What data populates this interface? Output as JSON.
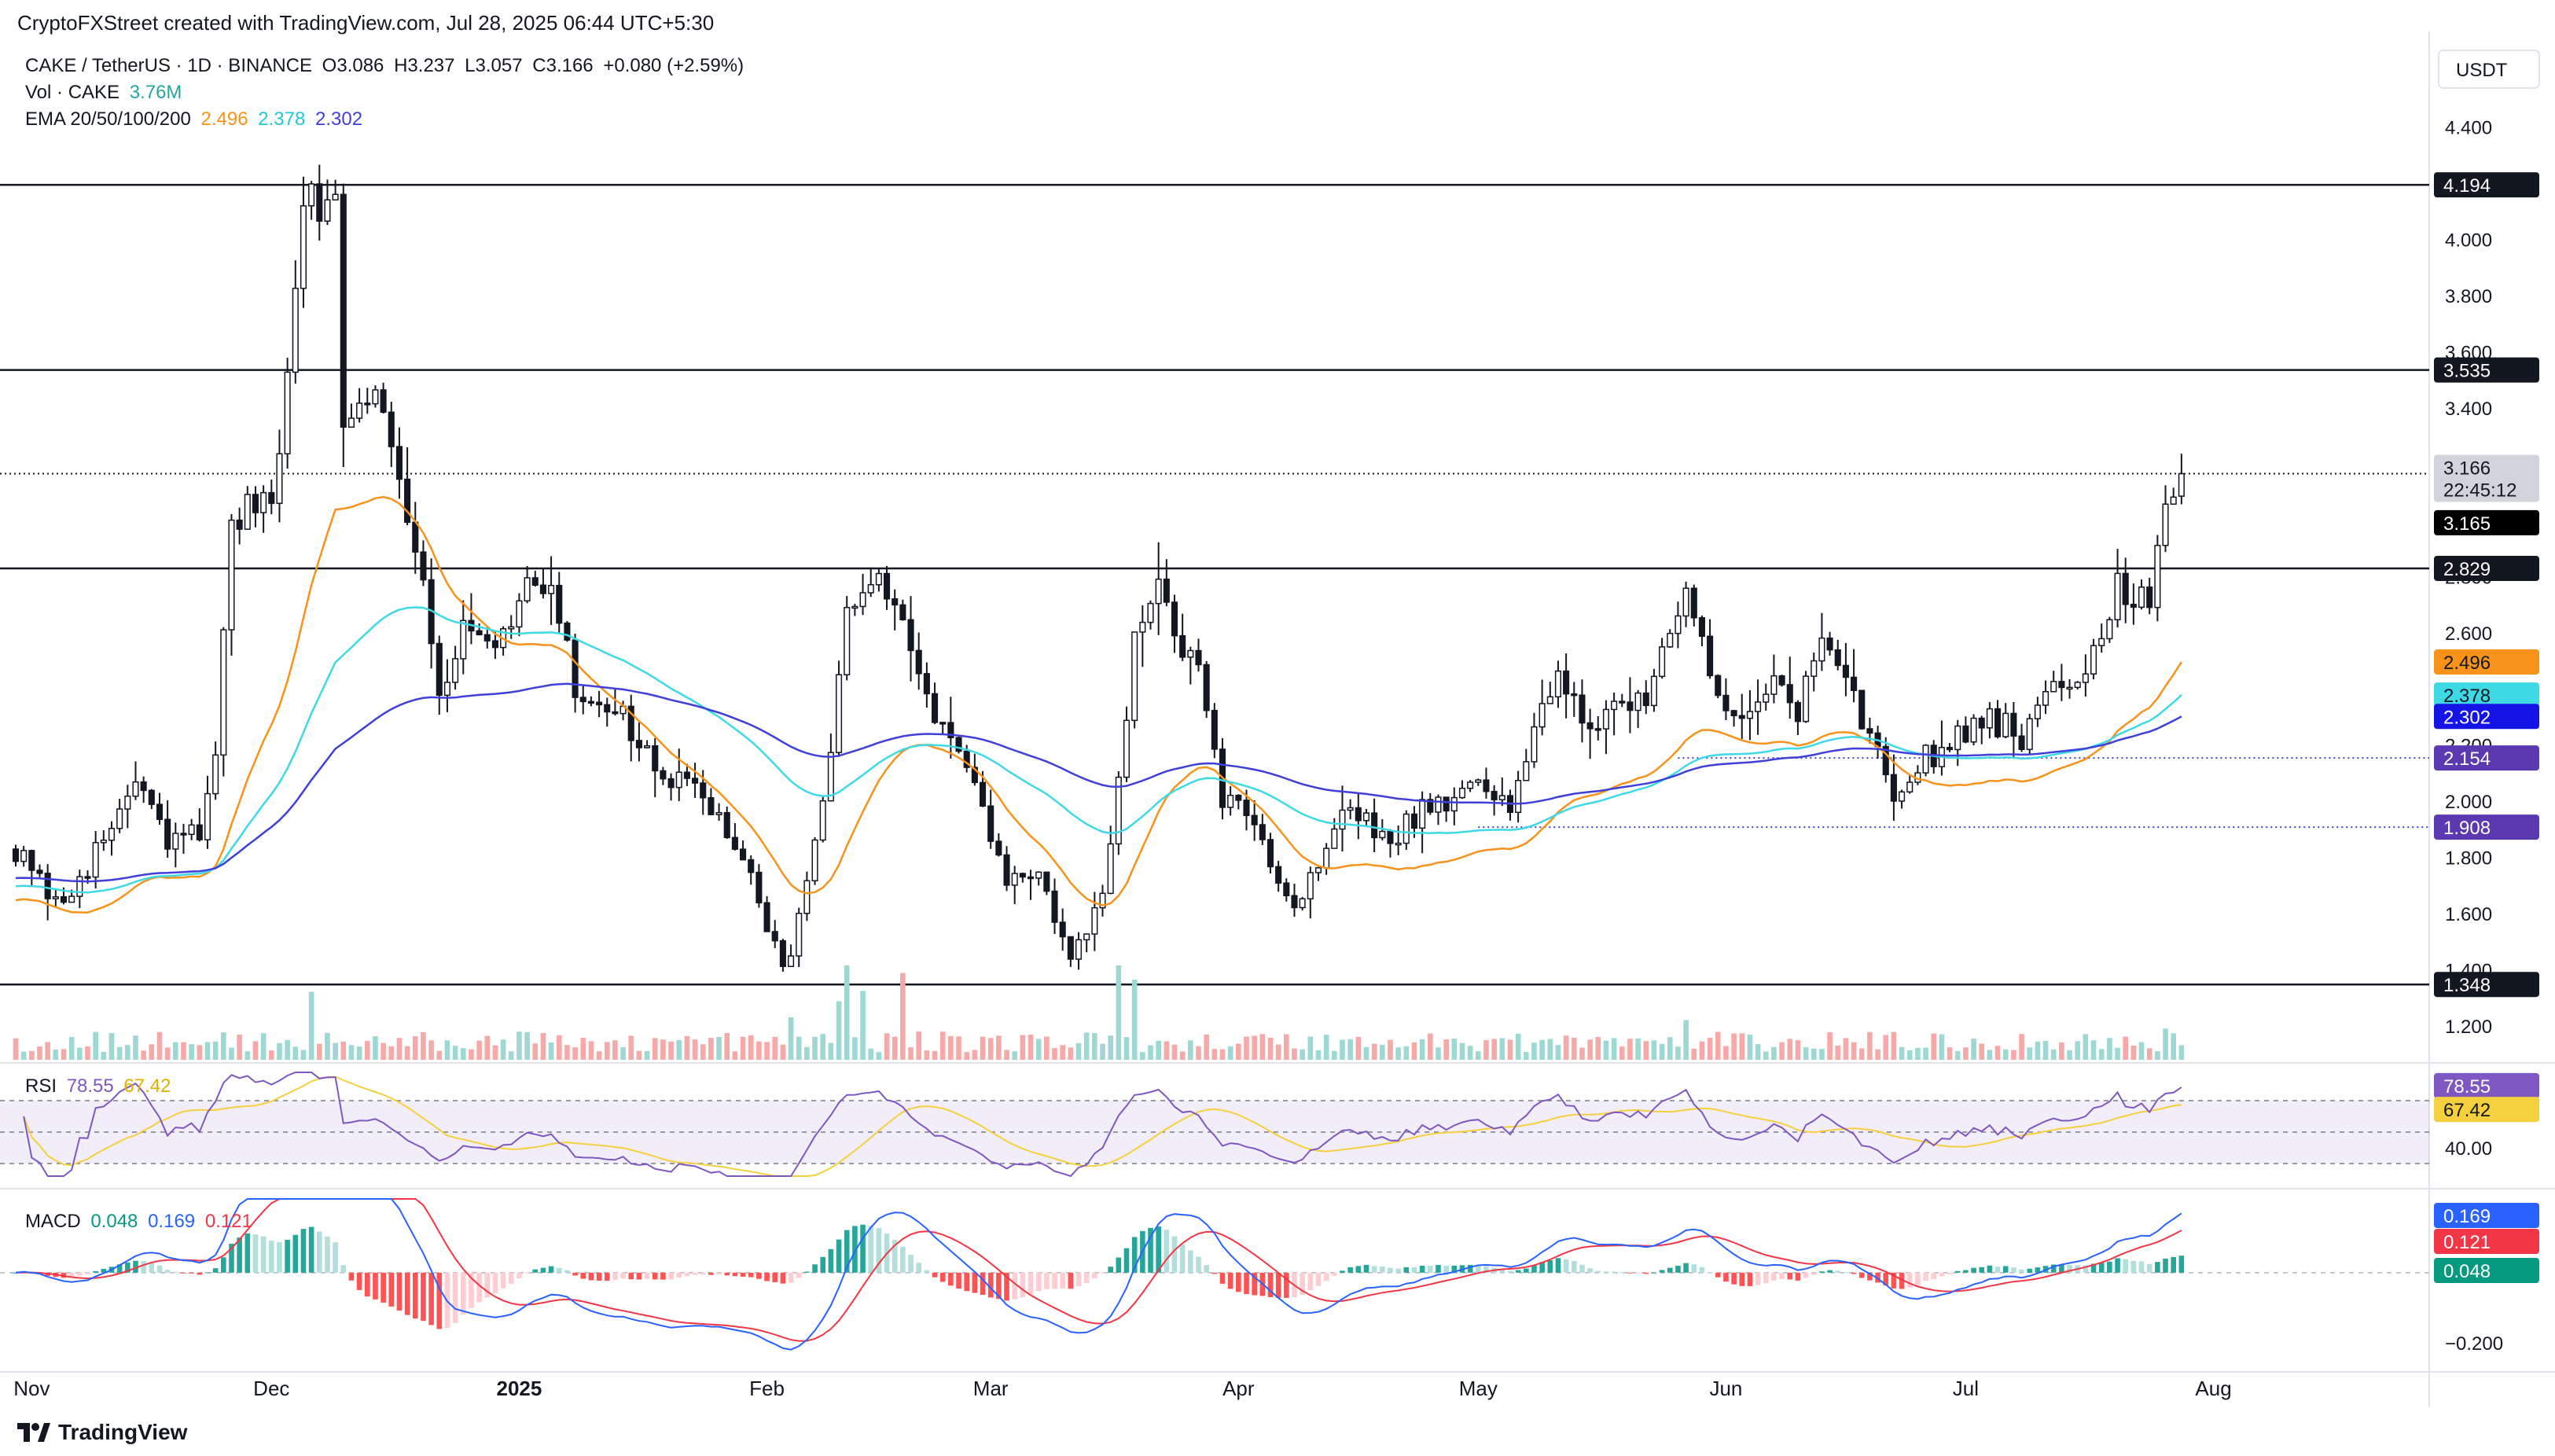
{
  "credit": "CryptoFXStreet created with TradingView.com, Jul 28, 2025 06:44 UTC+5:30",
  "header": {
    "symbol": "CAKE / TetherUS · 1D · BINANCE",
    "o_label": "O",
    "o": "3.086",
    "h_label": "H",
    "h": "3.237",
    "l_label": "L",
    "l": "3.057",
    "c_label": "C",
    "c": "3.166",
    "change": "+0.080 (+2.59%)",
    "vol_label": "Vol · CAKE",
    "vol": "3.76M",
    "ema_label": "EMA 20/50/100/200",
    "ema20": "2.496",
    "ema50": "2.378",
    "ema100": "2.302"
  },
  "currency_button": "USDT",
  "branding": "TradingView",
  "colors": {
    "up": "#26a69a",
    "down": "#ef5350",
    "vol_up": "#9dd8d2",
    "vol_down": "#f7a9a7",
    "ema20": "#f7931a",
    "ema50": "#3fd9e6",
    "ema100": "#3f3fd9",
    "rsi": "#7e57c2",
    "rsi_ma": "#f4d03f",
    "macd": "#2962ff",
    "signal": "#f23645"
  },
  "chart_data": [
    {
      "type": "candlestick",
      "title": "CAKE / TetherUS · 1D · BINANCE",
      "x_range": [
        "2024-10-30",
        "2025-08-28"
      ],
      "ylim": [
        1.08,
        4.74
      ],
      "y_ticks": [
        "1.200",
        "1.400",
        "1.600",
        "1.800",
        "2.000",
        "2.200",
        "2.400",
        "2.600",
        "2.800",
        "3.000",
        "3.200",
        "3.400",
        "3.600",
        "3.800",
        "4.000",
        "4.200",
        "4.400",
        "4.600"
      ],
      "x_labels": [
        {
          "date": "2024-11-01",
          "label": "Nov"
        },
        {
          "date": "2024-12-01",
          "label": "Dec"
        },
        {
          "date": "2025-01-01",
          "label": "2025"
        },
        {
          "date": "2025-02-01",
          "label": "Feb"
        },
        {
          "date": "2025-03-01",
          "label": "Mar"
        },
        {
          "date": "2025-04-01",
          "label": "Apr"
        },
        {
          "date": "2025-05-01",
          "label": "May"
        },
        {
          "date": "2025-06-01",
          "label": "Jun"
        },
        {
          "date": "2025-07-01",
          "label": "Jul"
        },
        {
          "date": "2025-08-01",
          "label": "Aug"
        }
      ],
      "support_resistance": [
        4.194,
        3.535,
        2.829,
        1.348
      ],
      "horizontal_lines": [
        {
          "value": 4.194,
          "style": "solid",
          "label": "4.194"
        },
        {
          "value": 3.535,
          "style": "solid",
          "label": "3.535"
        },
        {
          "value": 2.829,
          "style": "solid",
          "label": "2.829"
        },
        {
          "value": 1.348,
          "style": "solid",
          "label": "1.348"
        },
        {
          "value": 3.166,
          "style": "dotted",
          "label": "3.166"
        },
        {
          "value": 2.154,
          "style": "dotted",
          "start": "2025-05-26",
          "label": "2.154"
        },
        {
          "value": 1.908,
          "style": "dotted",
          "start": "2025-05-01",
          "label": "1.908"
        }
      ],
      "price_labels": [
        {
          "value": 3.166,
          "text": "3.166",
          "sub": "22:45:12",
          "bg": "#d1d4dc",
          "fg": "#131722"
        },
        {
          "value": 3.165,
          "text": "3.165",
          "bg": "#000000",
          "fg": "#ffffff"
        },
        {
          "value": 2.496,
          "text": "2.496",
          "bg": "#f7931a",
          "fg": "#131722"
        },
        {
          "value": 2.378,
          "text": "2.378",
          "bg": "#3fd9e6",
          "fg": "#131722"
        },
        {
          "value": 2.302,
          "text": "2.302",
          "bg": "#1414e6",
          "fg": "#ffffff"
        },
        {
          "value": 2.154,
          "text": "2.154",
          "bg": "#5b3ab1",
          "fg": "#ffffff"
        },
        {
          "value": 1.908,
          "text": "1.908",
          "bg": "#5b3ab1",
          "fg": "#ffffff"
        }
      ],
      "candle_anchors": [
        [
          "2024-10-30",
          1.83
        ],
        [
          "2024-11-04",
          1.62
        ],
        [
          "2024-11-10",
          1.85
        ],
        [
          "2024-11-14",
          2.08
        ],
        [
          "2024-11-18",
          1.84
        ],
        [
          "2024-11-22",
          1.9
        ],
        [
          "2024-11-24",
          2.2
        ],
        [
          "2024-11-26",
          2.95
        ],
        [
          "2024-11-29",
          3.05
        ],
        [
          "2024-12-01",
          3.0
        ],
        [
          "2024-12-03",
          3.5
        ],
        [
          "2024-12-05",
          4.2
        ],
        [
          "2024-12-07",
          4.05
        ],
        [
          "2024-12-09",
          4.2
        ],
        [
          "2024-12-10",
          3.4
        ],
        [
          "2024-12-13",
          3.5
        ],
        [
          "2024-12-16",
          3.3
        ],
        [
          "2024-12-20",
          2.8
        ],
        [
          "2024-12-22",
          2.4
        ],
        [
          "2024-12-25",
          2.6
        ],
        [
          "2024-12-29",
          2.5
        ],
        [
          "2025-01-02",
          2.75
        ],
        [
          "2025-01-05",
          2.8
        ],
        [
          "2025-01-08",
          2.38
        ],
        [
          "2025-01-13",
          2.35
        ],
        [
          "2025-01-18",
          2.1
        ],
        [
          "2025-01-25",
          2.0
        ],
        [
          "2025-01-31",
          1.65
        ],
        [
          "2025-02-03",
          1.38
        ],
        [
          "2025-02-06",
          1.7
        ],
        [
          "2025-02-09",
          2.15
        ],
        [
          "2025-02-11",
          2.65
        ],
        [
          "2025-02-15",
          2.8
        ],
        [
          "2025-02-20",
          2.45
        ],
        [
          "2025-02-24",
          2.22
        ],
        [
          "2025-02-28",
          1.95
        ],
        [
          "2025-03-03",
          1.72
        ],
        [
          "2025-03-07",
          1.75
        ],
        [
          "2025-03-11",
          1.42
        ],
        [
          "2025-03-15",
          1.65
        ],
        [
          "2025-03-17",
          2.05
        ],
        [
          "2025-03-19",
          2.55
        ],
        [
          "2025-03-22",
          2.75
        ],
        [
          "2025-03-27",
          2.45
        ],
        [
          "2025-03-30",
          2.0
        ],
        [
          "2025-04-03",
          1.92
        ],
        [
          "2025-04-08",
          1.62
        ],
        [
          "2025-04-11",
          1.78
        ],
        [
          "2025-04-14",
          1.98
        ],
        [
          "2025-04-20",
          1.85
        ],
        [
          "2025-04-24",
          1.98
        ],
        [
          "2025-04-30",
          2.05
        ],
        [
          "2025-05-05",
          1.98
        ],
        [
          "2025-05-08",
          2.3
        ],
        [
          "2025-05-11",
          2.45
        ],
        [
          "2025-05-16",
          2.25
        ],
        [
          "2025-05-22",
          2.4
        ],
        [
          "2025-05-27",
          2.78
        ],
        [
          "2025-05-30",
          2.4
        ],
        [
          "2025-06-03",
          2.32
        ],
        [
          "2025-06-07",
          2.45
        ],
        [
          "2025-06-10",
          2.3
        ],
        [
          "2025-06-13",
          2.6
        ],
        [
          "2025-06-17",
          2.35
        ],
        [
          "2025-06-20",
          2.18
        ],
        [
          "2025-06-22",
          2.05
        ],
        [
          "2025-06-26",
          2.15
        ],
        [
          "2025-06-30",
          2.25
        ],
        [
          "2025-07-04",
          2.3
        ],
        [
          "2025-07-08",
          2.22
        ],
        [
          "2025-07-11",
          2.45
        ],
        [
          "2025-07-14",
          2.38
        ],
        [
          "2025-07-17",
          2.55
        ],
        [
          "2025-07-20",
          2.75
        ],
        [
          "2025-07-22",
          2.7
        ],
        [
          "2025-07-24",
          2.75
        ],
        [
          "2025-07-26",
          3.09
        ],
        [
          "2025-07-28",
          3.166
        ]
      ],
      "last_candle": {
        "date": "2025-07-28",
        "o": 3.086,
        "h": 3.237,
        "l": 3.057,
        "c": 3.166
      },
      "ema_values": {
        "ema20": 2.496,
        "ema50": 2.378,
        "ema100": 2.302
      }
    },
    {
      "type": "bar",
      "title": "Vol · CAKE",
      "last_value": "3.76M",
      "notable_spikes": [
        {
          "date": "2024-12-06",
          "value_rel": 0.72
        },
        {
          "date": "2025-02-04",
          "value_rel": 0.45
        },
        {
          "date": "2025-02-10",
          "value_rel": 0.62
        },
        {
          "date": "2025-02-11",
          "value_rel": 1.0
        },
        {
          "date": "2025-02-13",
          "value_rel": 0.73
        },
        {
          "date": "2025-02-18",
          "value_rel": 0.92
        },
        {
          "date": "2025-03-17",
          "value_rel": 1.0
        },
        {
          "date": "2025-03-19",
          "value_rel": 0.85
        },
        {
          "date": "2025-05-27",
          "value_rel": 0.42
        },
        {
          "date": "2025-07-26",
          "value_rel": 0.33
        }
      ]
    },
    {
      "type": "line",
      "title": "RSI",
      "series": [
        {
          "name": "RSI",
          "last": "78.55"
        },
        {
          "name": "RSI MA",
          "last": "67.42"
        }
      ],
      "ylim": [
        20,
        90
      ],
      "bands": [
        70,
        50,
        30
      ],
      "y_ticks": [
        "40.00"
      ],
      "price_labels": [
        {
          "value": 78.55,
          "text": "78.55",
          "bg": "#7e57c2",
          "fg": "#ffffff"
        },
        {
          "value": 67.42,
          "text": "67.42",
          "bg": "#f4d03f",
          "fg": "#131722"
        }
      ]
    },
    {
      "type": "bar",
      "title": "MACD",
      "series": [
        {
          "name": "Histogram",
          "last": "0.048"
        },
        {
          "name": "MACD",
          "last": "0.169"
        },
        {
          "name": "Signal",
          "last": "0.121"
        }
      ],
      "ylim": [
        -0.26,
        0.21
      ],
      "y_ticks": [
        "0.000",
        "−0.200"
      ],
      "price_labels": [
        {
          "value": 0.169,
          "text": "0.169",
          "bg": "#2962ff",
          "fg": "#ffffff"
        },
        {
          "value": 0.121,
          "text": "0.121",
          "bg": "#f23645",
          "fg": "#ffffff"
        },
        {
          "value": 0.048,
          "text": "0.048",
          "bg": "#089981",
          "fg": "#ffffff"
        }
      ]
    }
  ]
}
